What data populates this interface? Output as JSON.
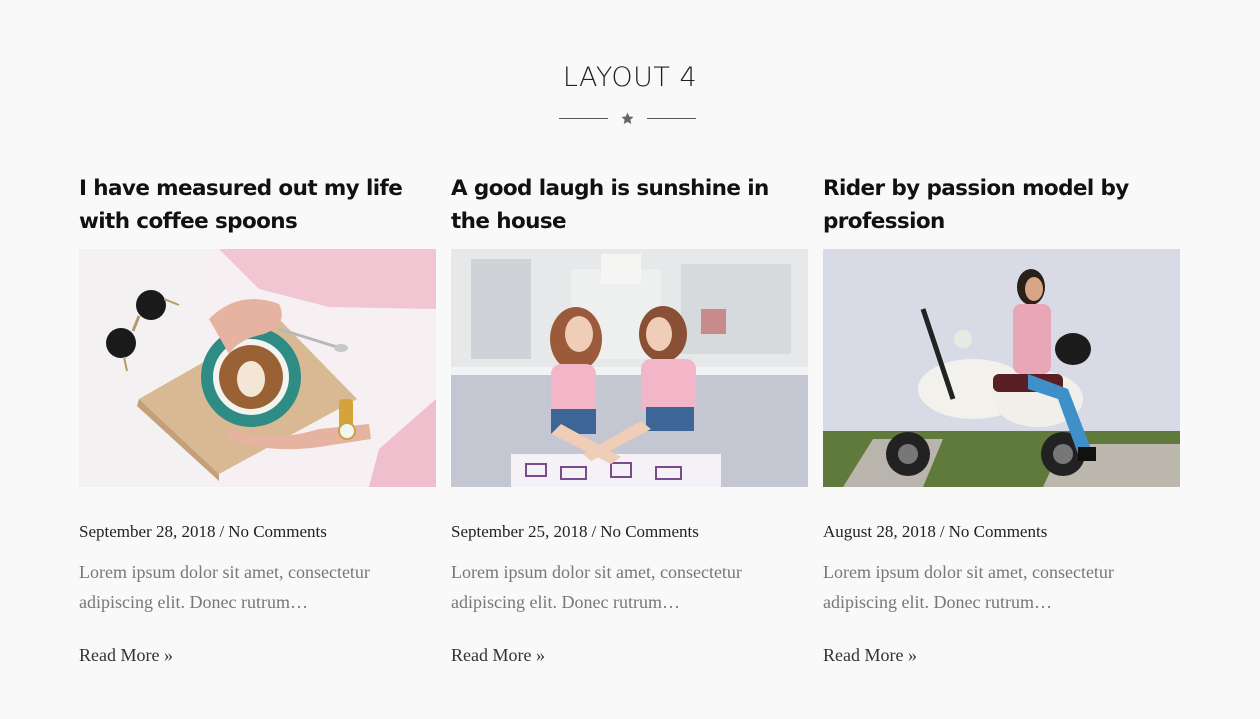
{
  "section": {
    "title": "LAYOUT 4",
    "divider_icon": "star-icon"
  },
  "posts": [
    {
      "title": "I have measured out my life with coffee spoons",
      "image": "coffee-latte-art-image",
      "date": "September 28, 2018",
      "separator": "/",
      "comments": "No Comments",
      "excerpt": "Lorem ipsum dolor sit amet, consectetur adipiscing elit. Donec rutrum…",
      "read_more": "Read More »"
    },
    {
      "title": "A good laugh is sunshine in the house",
      "image": "two-girls-laughing-image",
      "date": "September 25, 2018",
      "separator": "/",
      "comments": "No Comments",
      "excerpt": "Lorem ipsum dolor sit amet, consectetur adipiscing elit. Donec rutrum…",
      "read_more": "Read More »"
    },
    {
      "title": "Rider by passion model by profession",
      "image": "woman-on-scooter-image",
      "date": "August 28, 2018",
      "separator": "/",
      "comments": "No Comments",
      "excerpt": "Lorem ipsum dolor sit amet, consectetur adipiscing elit. Donec rutrum…",
      "read_more": "Read More »"
    }
  ],
  "colors": {
    "background": "#f9f9f9",
    "title": "#111111",
    "excerpt": "#777777",
    "divider": "#555555"
  }
}
